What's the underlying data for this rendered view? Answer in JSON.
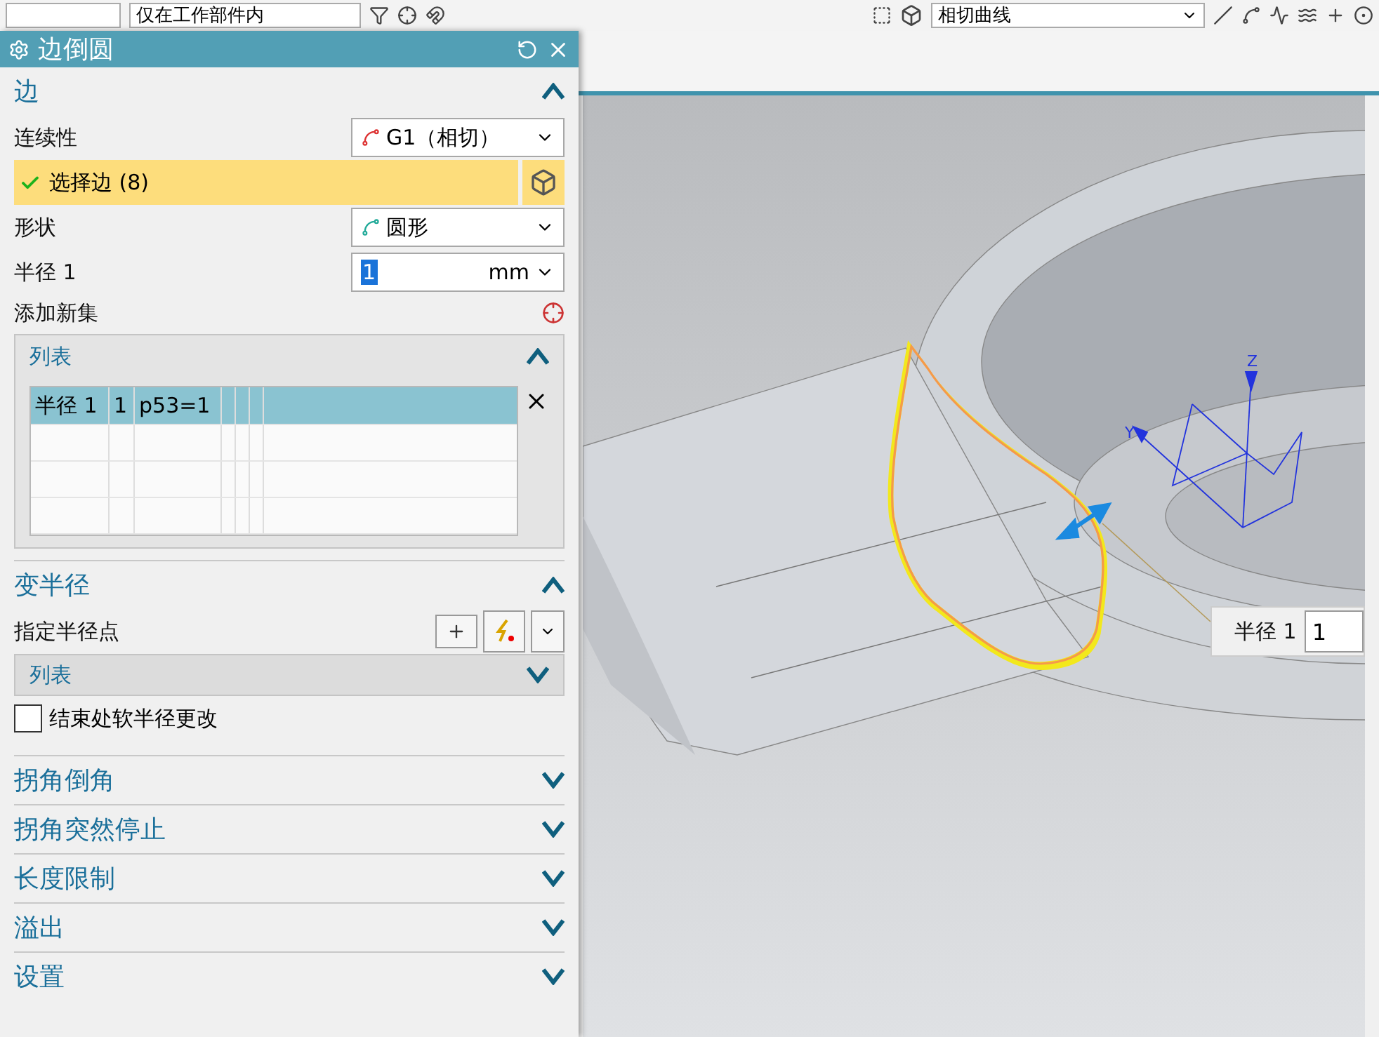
{
  "toolbar": {
    "filter_dropdown": "仅在工作部件内",
    "curve_rule_dropdown": "相切曲线"
  },
  "dialog": {
    "title": "边倒圆",
    "edge_section": {
      "title": "边",
      "expanded": true,
      "continuity": {
        "label": "连续性",
        "value": "G1（相切）"
      },
      "select_edge": {
        "label": "选择边 (8)",
        "done": true
      },
      "shape": {
        "label": "形状",
        "value": "圆形"
      },
      "radius": {
        "label": "半径 1",
        "value": "1",
        "unit": "mm"
      },
      "add_new_set": {
        "label": "添加新集"
      },
      "list": {
        "title": "列表",
        "expanded": true,
        "rows": [
          {
            "cells": [
              "半径 1",
              "1",
              "p53=1"
            ],
            "selected": true
          }
        ]
      }
    },
    "variable_radius": {
      "title": "变半径",
      "expanded": true,
      "point_label": "指定半径点",
      "list": {
        "title": "列表",
        "expanded": false
      },
      "soft_change": {
        "label": "结束处软半径更改",
        "checked": false
      }
    },
    "collapsed_sections": [
      {
        "title": "拐角倒角",
        "expanded": false
      },
      {
        "title": "拐角突然停止",
        "expanded": false
      },
      {
        "title": "长度限制",
        "expanded": false
      },
      {
        "title": "溢出",
        "expanded": false
      },
      {
        "title": "设置",
        "expanded": false
      }
    ]
  },
  "viewport": {
    "radius_label": "半径 1",
    "radius_value": "1",
    "axis_z": "Z",
    "axis_y": "Y"
  }
}
